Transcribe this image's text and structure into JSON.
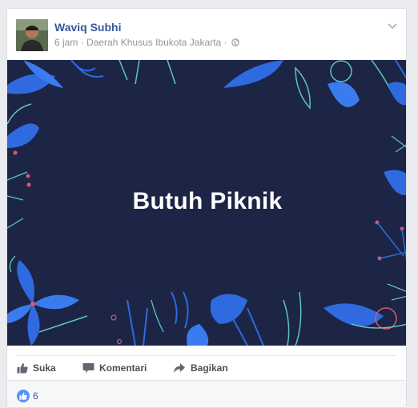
{
  "post": {
    "author": "Waviq Subhi",
    "time": "6 jam",
    "separator": "·",
    "location": "Daerah Khusus Ibukota Jakarta",
    "privacy_icon": "globe-icon",
    "text": "Butuh Piknik",
    "background_color": "#1c2545"
  },
  "actions": {
    "like": "Suka",
    "comment": "Komentari",
    "share": "Bagikan"
  },
  "reactions": {
    "icon": "like-icon",
    "count": "6"
  },
  "colors": {
    "link": "#365899",
    "muted": "#90949c",
    "accent": "#5890ff",
    "leaf_blue": "#2f6ae0",
    "leaf_teal": "#5cc6c0",
    "berry": "#e05570"
  }
}
